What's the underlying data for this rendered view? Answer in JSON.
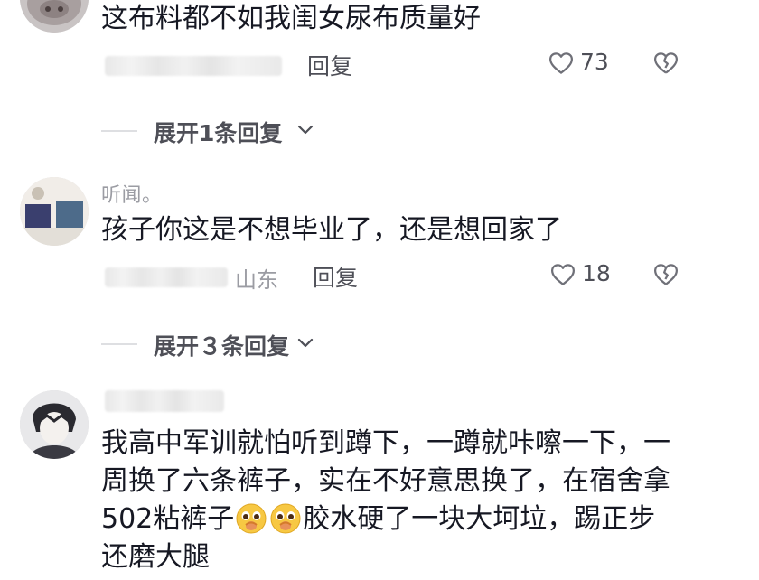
{
  "comments": [
    {
      "username": "",
      "text": "这布料都不如我闺女尿布质量好",
      "location": "",
      "reply_label": "回复",
      "like_count": "73",
      "expand_label": "展开1条回复"
    },
    {
      "username": "听闻。",
      "text": "孩子你这是不想毕业了，还是想回家了",
      "location": "山东",
      "reply_label": "回复",
      "like_count": "18",
      "expand_label": "展开３条回复"
    },
    {
      "username": "",
      "text_part1": "我高中军训就怕听到蹲下，一蹲就咔嚓一下，一周换了六条裤子，实在不好意思换了，在宿舍拿502粘裤子",
      "text_part2": "胶水硬了一块大坷垃，踢正步还磨大腿",
      "emojis": [
        "pleading-emoji",
        "pleading-emoji"
      ]
    }
  ],
  "icons": {
    "like": "heart-outline-icon",
    "dislike": "broken-heart-icon",
    "expand": "chevron-down-icon"
  },
  "colors": {
    "text_primary": "#161823",
    "text_secondary": "#9b9ca3",
    "action": "#4e4f57"
  }
}
